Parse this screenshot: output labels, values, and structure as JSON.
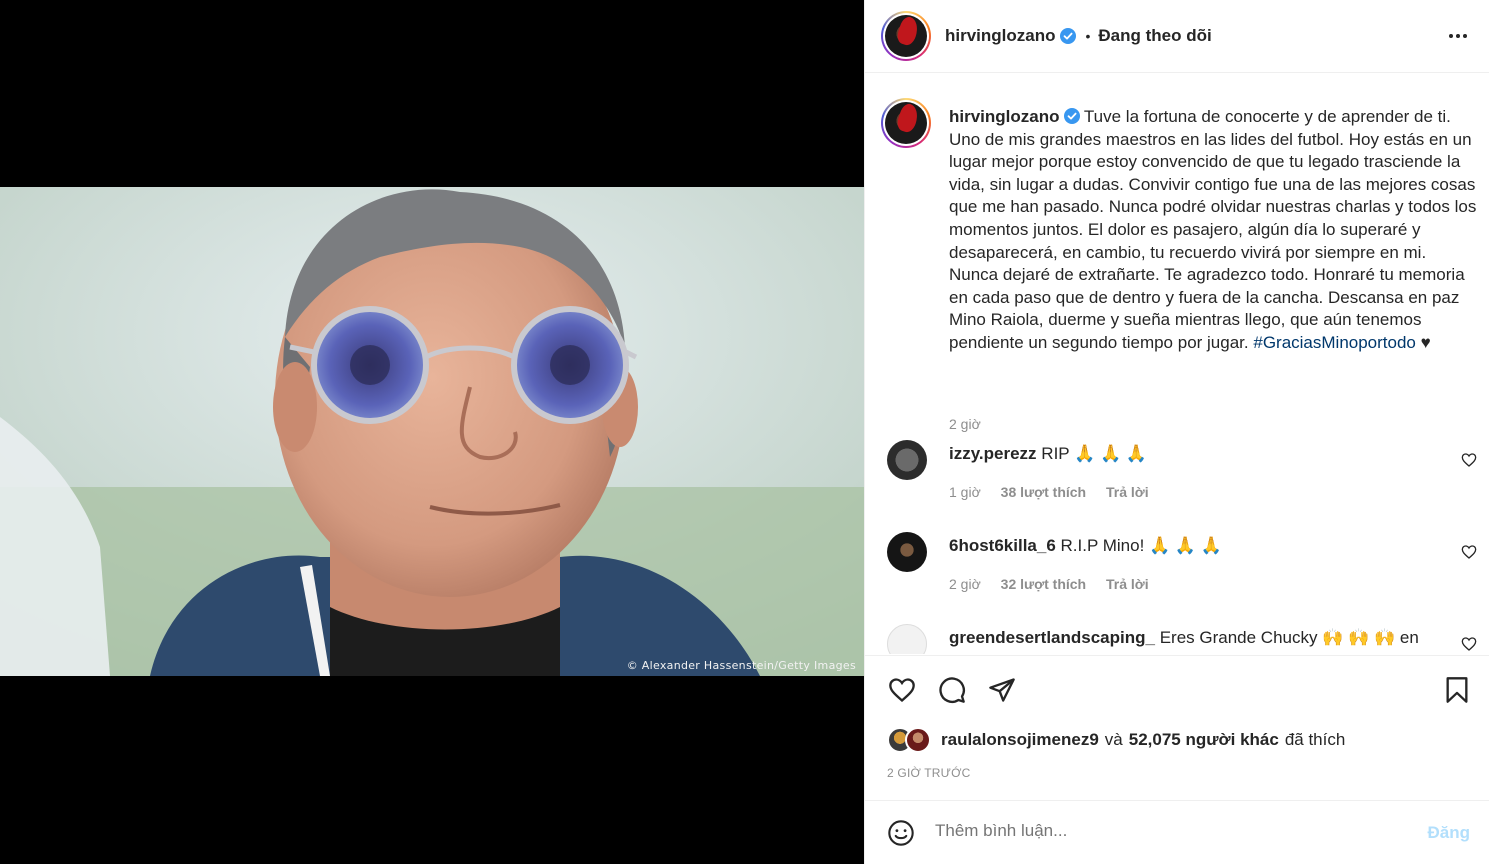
{
  "media": {
    "credit": "© Alexander Hassenstein/Getty Images"
  },
  "header": {
    "username": "hirvinglozano",
    "separator": "•",
    "follow_status": "Đang theo dõi"
  },
  "caption": {
    "username": "hirvinglozano",
    "text": "Tuve la fortuna de conocerte y de aprender de ti. Uno de mis grandes maestros en las lides del futbol. Hoy estás en un lugar mejor porque estoy convencido de que tu legado trasciende la vida, sin lugar a dudas. Convivir contigo fue una de las mejores cosas que me han pasado. Nunca podré olvidar nuestras charlas y todos los momentos juntos. El dolor es pasajero, algún día lo superaré y desaparecerá, en cambio, tu recuerdo vivirá por siempre en mi. Nunca dejaré de extrañarte. Te agradezco todo. Honraré tu memoria en cada paso que de dentro y fuera de la cancha. Descansa en paz Mino Raiola, duerme y sueña mientras llego, que aún tenemos pendiente un segundo tiempo por jugar.",
    "hashtag": "#GraciasMinoportodo",
    "heart": "♥",
    "time": "2 giờ"
  },
  "comments": [
    {
      "username": "izzy.perezz",
      "text": "RIP 🙏 🙏 🙏",
      "time": "1 giờ",
      "likes": "38 lượt thích",
      "reply": "Trả lời"
    },
    {
      "username": "6host6killa_6",
      "text": "R.I.P Mino! 🙏 🙏 🙏",
      "time": "2 giờ",
      "likes": "32 lượt thích",
      "reply": "Trả lời"
    },
    {
      "username": "greendesertlandscaping_",
      "text": "Eres Grande Chucky 🙌 🙌 🙌 en",
      "time": "",
      "likes": "",
      "reply": ""
    }
  ],
  "likes": {
    "first_user": "raulalonsojimenez9",
    "conj": "và",
    "others": "52,075 người khác",
    "suffix": "đã thích"
  },
  "post_time": "2 GIỜ TRƯỚC",
  "add_comment": {
    "placeholder": "Thêm bình luận...",
    "post_label": "Đăng"
  },
  "icons": {
    "like": "heart-icon",
    "comment": "comment-icon",
    "share": "share-icon",
    "save": "bookmark-icon",
    "emoji": "emoji-icon",
    "more": "more-icon"
  },
  "colors": {
    "verified": "#3897f0",
    "hashtag": "#00376b",
    "post_button_disabled": "#b2dffc"
  }
}
